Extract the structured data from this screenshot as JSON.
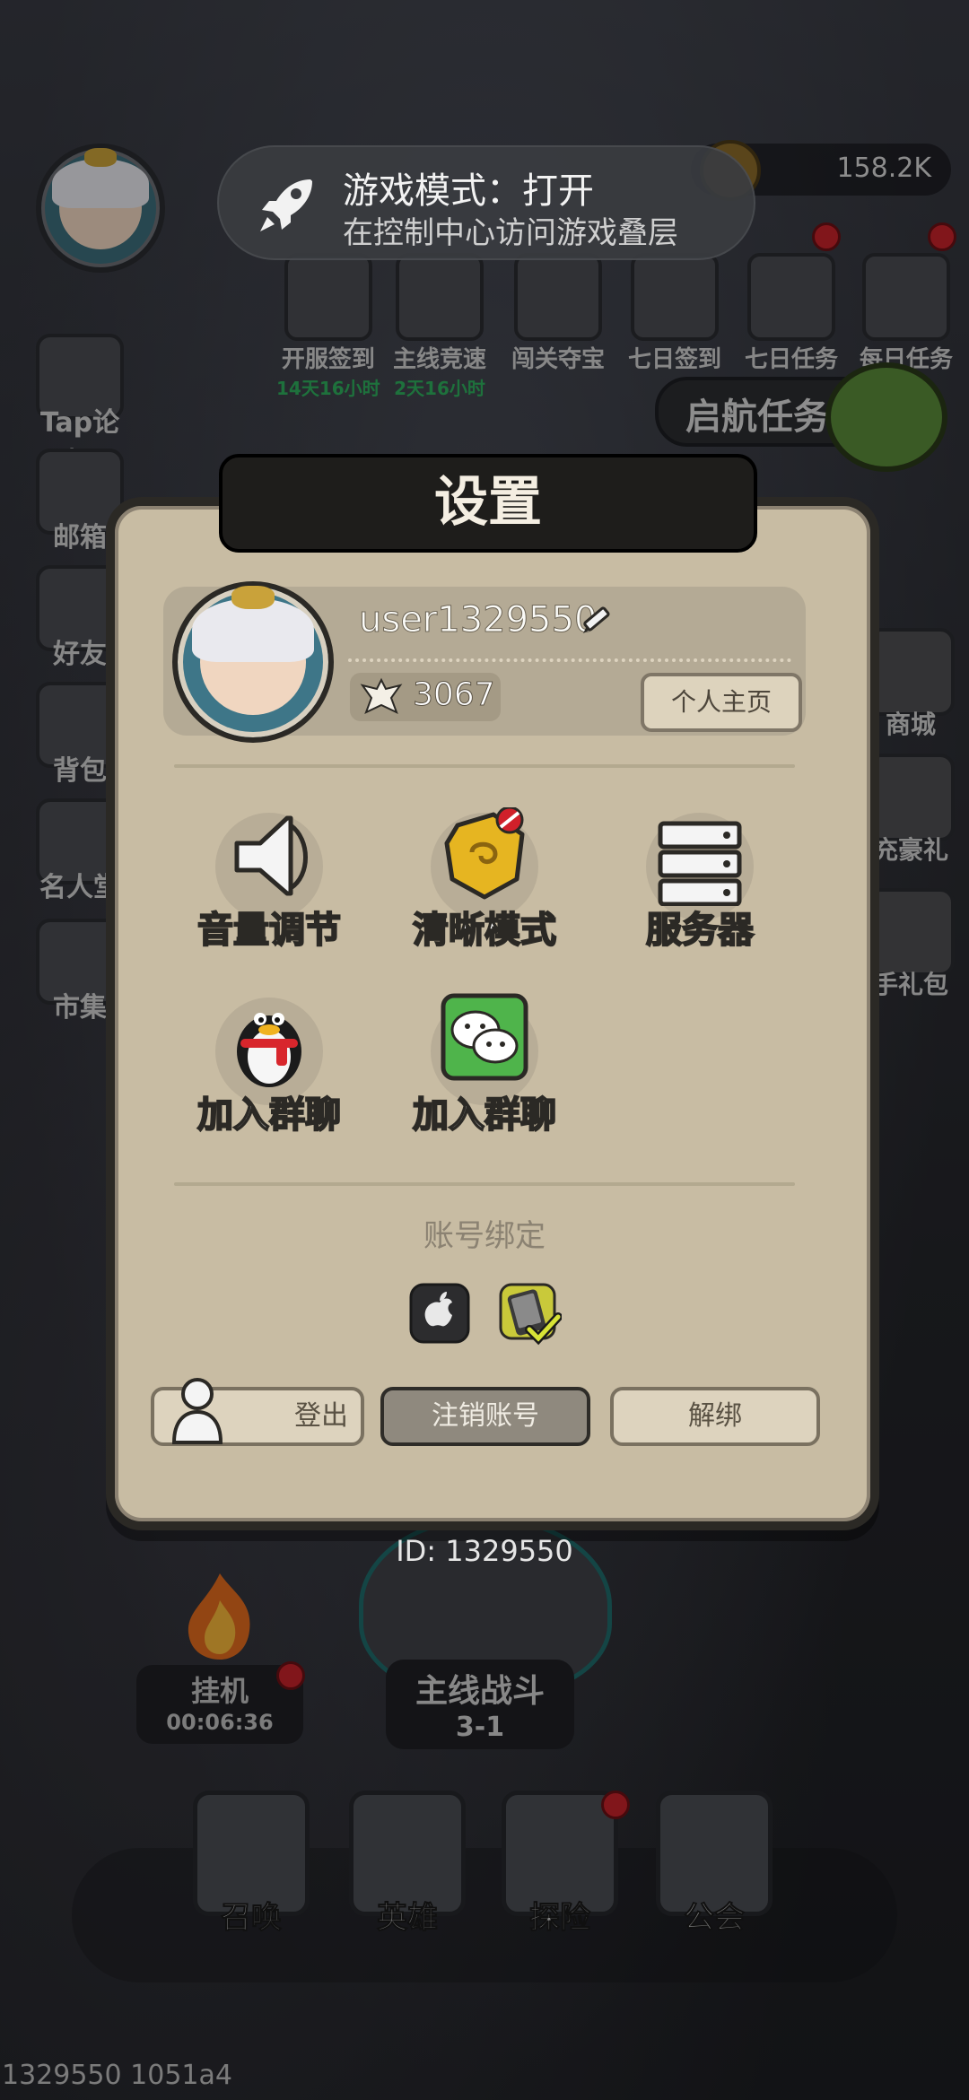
{
  "toast": {
    "title": "游戏模式：打开",
    "subtitle": "在控制中心访问游戏叠层",
    "icon": "rocket-icon"
  },
  "hud": {
    "currency_value": "158.2K",
    "top_icons": [
      {
        "label": "开服签到",
        "timer": "14天16小时",
        "badge": false
      },
      {
        "label": "主线竞速",
        "timer": "2天16小时",
        "badge": false
      },
      {
        "label": "闯关夺宝",
        "timer": "",
        "badge": false
      },
      {
        "label": "七日签到",
        "timer": "",
        "badge": false
      },
      {
        "label": "七日任务",
        "timer": "",
        "badge": true
      },
      {
        "label": "每日任务",
        "timer": "",
        "badge": true
      }
    ],
    "left_icons": [
      "Tap论坛",
      "邮箱",
      "好友",
      "背包",
      "名人堂",
      "市集"
    ],
    "right_icons": [
      "商城",
      "充豪礼",
      "手礼包"
    ],
    "launch_task": "启航任务"
  },
  "settings": {
    "title": "设置",
    "username": "user1329550",
    "power": "3067",
    "home_button": "个人主页",
    "grid": [
      {
        "label": "音量调节",
        "icon": "speaker-icon"
      },
      {
        "label": "清晰模式",
        "icon": "quality-gem-icon"
      },
      {
        "label": "服务器",
        "icon": "server-icon"
      },
      {
        "label": "加入群聊",
        "icon": "qq-penguin-icon"
      },
      {
        "label": "加入群聊",
        "icon": "wechat-icon"
      }
    ],
    "binding_title": "账号绑定",
    "binding_icons": [
      "apple-icon",
      "phone-bound-icon"
    ],
    "buttons": {
      "logout": "登出",
      "delete_account": "注销账号",
      "unbind": "解绑"
    }
  },
  "player_id": "ID: 1329550",
  "idle": {
    "label": "挂机",
    "time": "00:06:36"
  },
  "battle": {
    "label": "主线战斗",
    "stage": "3-1"
  },
  "dock": [
    "召唤",
    "英雄",
    "探险",
    "公会"
  ],
  "debug_text": "1329550 1051a4"
}
